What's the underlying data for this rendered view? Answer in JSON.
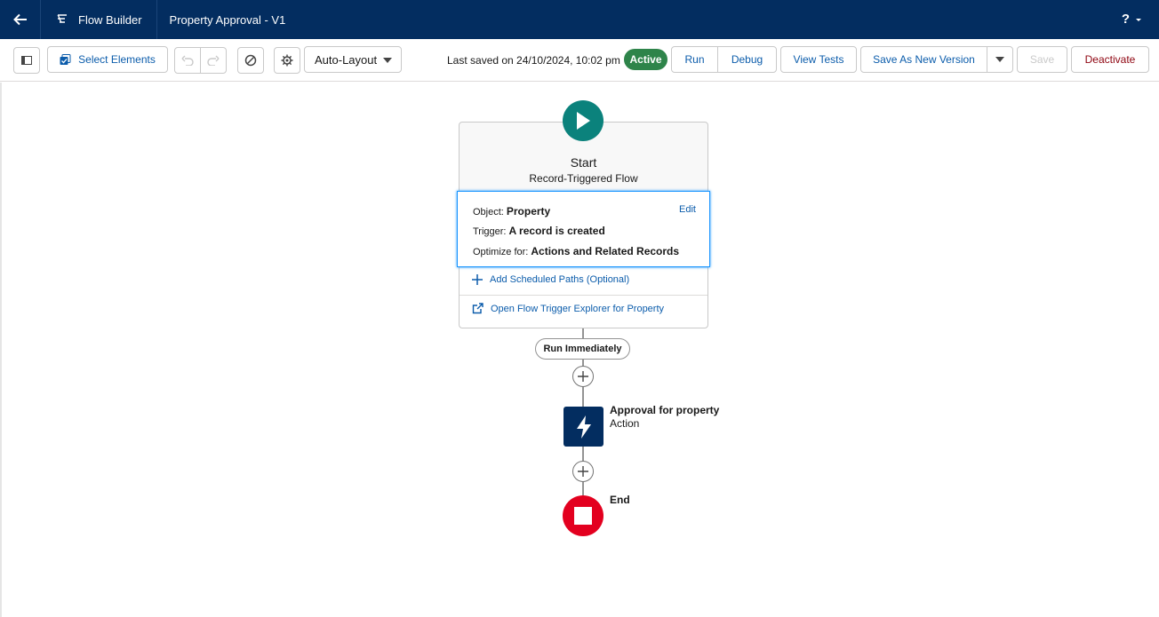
{
  "header": {
    "back_icon": "arrow-left-icon",
    "app_icon": "flow-icon",
    "app_name": "Flow Builder",
    "flow_title": "Property Approval - V1",
    "help_label": "?"
  },
  "toolbar": {
    "select_elements_label": "Select Elements",
    "layout_value": "Auto-Layout",
    "last_saved": "Last saved on 24/10/2024, 10:02 pm",
    "status_badge": "Active",
    "run_label": "Run",
    "debug_label": "Debug",
    "view_tests_label": "View Tests",
    "save_as_new_version_label": "Save As New Version",
    "save_label": "Save",
    "deactivate_label": "Deactivate"
  },
  "start_node": {
    "title": "Start",
    "subtitle": "Record-Triggered Flow",
    "object_label": "Object:",
    "object_value": "Property",
    "edit_label": "Edit",
    "trigger_label": "Trigger:",
    "trigger_value": "A record is created",
    "optimize_label": "Optimize for:",
    "optimize_value": "Actions and Related Records",
    "scheduled_paths_link": "Add Scheduled Paths (Optional)",
    "trigger_explorer_link": "Open Flow Trigger Explorer for Property"
  },
  "path": {
    "run_immediately_label": "Run Immediately"
  },
  "action_node": {
    "title": "Approval for property",
    "type": "Action"
  },
  "end_node": {
    "title": "End"
  },
  "colors": {
    "header_bg": "#032d60",
    "start_icon": "#0b827c",
    "action_icon": "#032d60",
    "end_icon": "#e3001f",
    "active_badge": "#2e844a",
    "link": "#0b5cab",
    "deactivate": "#8e030f"
  }
}
